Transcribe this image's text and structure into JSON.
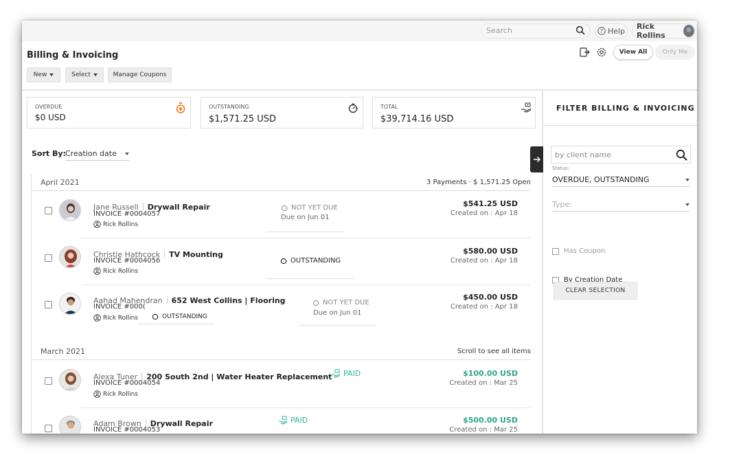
{
  "topbar": {
    "search_placeholder": "Search",
    "help_label": "Help",
    "user_name": "Rick Rollins"
  },
  "header": {
    "title": "Billing & Invoicing",
    "new_label": "New",
    "select_label": "Select",
    "coupons_label": "Manage Coupons",
    "view_all_label": "View All",
    "only_me_label": "Only Me"
  },
  "summary": [
    {
      "label": "OVERDUE",
      "value": "$0 USD",
      "icon": "stopwatch-icon",
      "color": "#f07a1a"
    },
    {
      "label": "OUTSTANDING",
      "value": "$1,571.25 USD",
      "icon": "outstanding-timer-icon",
      "color": "#333333"
    },
    {
      "label": "TOTAL",
      "value": "$39,714.16 USD",
      "icon": "money-hand-icon",
      "color": "#333333"
    }
  ],
  "sort": {
    "label": "Sort By:",
    "value": "Creation date"
  },
  "groups": [
    {
      "title": "April 2021",
      "summary": "3 Payments  · $ 1,571.25 Open",
      "rows": [
        {
          "client": "Jane Russell",
          "job": "Drywall Repair",
          "invoice": "INVOICE #0004057",
          "owner": "Rick Rollins",
          "status": "NOT YET DUE",
          "due": "Due on Jun 01",
          "amount": "$541.25 USD",
          "created": "Created on : Apr 18"
        },
        {
          "client": "Christie Hathcock",
          "job": "TV Mounting",
          "invoice": "INVOICE #0004056",
          "owner": "Rick Rollins",
          "status": "OUTSTANDING",
          "due": "",
          "amount": "$580.00 USD",
          "created": "Created on : Apr 18"
        },
        {
          "client": "Aahad Mahendran",
          "job": "652 West Collins | Flooring",
          "invoice": "INVOICE #000(",
          "owner": "Rick Rollins",
          "status": "NOT YET DUE",
          "due": "Due on Jun 01",
          "overlay_status": "OUTSTANDING",
          "amount": "$450.00 USD",
          "created": "Created on : Apr 18"
        }
      ]
    },
    {
      "title": "March 2021",
      "summary": "Scroll to see all items",
      "rows": [
        {
          "client": "Alexa Tuner",
          "job": "200 South 2nd | Water Heater Replacement",
          "invoice": "INVOICE #0004054",
          "owner": "Rick Rollins",
          "status": "PAID",
          "amount": "$100.00 USD",
          "created": "Created on : Mar 25"
        },
        {
          "client": "Adam Brown",
          "job": "Drywall Repair",
          "invoice": "INVOICE #0004053",
          "owner": "",
          "status": "PAID",
          "amount": "$500.00 USD",
          "created": "Created on : Mar 25"
        }
      ]
    }
  ],
  "filter": {
    "title": "FILTER BILLING & INVOICING",
    "search_placeholder": "by client name",
    "status_label": "Status:",
    "status_value": "OVERDUE, OUTSTANDING",
    "type_placeholder": "Type:",
    "has_coupon": "Has Coupon",
    "by_creation_date": "By Creation Date",
    "clear_label": "CLEAR SELECTION"
  },
  "colors": {
    "paid": "#2fb39a",
    "overdue_accent": "#f07a1a"
  }
}
